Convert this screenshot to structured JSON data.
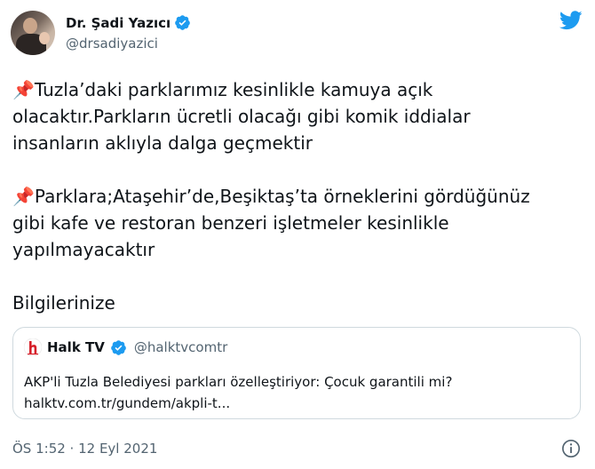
{
  "author": {
    "display_name": "Dr. Şadi Yazıcı",
    "handle": "@drsadiyazici"
  },
  "tweet": {
    "paragraph1": "Tuzla’daki parklarımız kesinlikle kamuya açık\nolacaktır.Parkların ücretli olacağı gibi komik iddialar\ninsanların aklıyla dalga geçmektir",
    "paragraph2": "Parklara;Ataşehir’de,Beşiktaş’ta örneklerini gördüğünüz\ngibi kafe ve restoran benzeri işletmeler kesinlikle\nyapılmayacaktır",
    "paragraph3": "Bilgilerinize",
    "pin_emoji": "📌"
  },
  "quoted": {
    "name": "Halk TV",
    "handle": "@halktvcomtr",
    "title": "AKP'li Tuzla Belediyesi parkları özelleştiriyor: Çocuk garantili mi?",
    "link": "halktv.com.tr/gundem/akpli-t..."
  },
  "timestamp": "ÖS 1:52 · 12 Eyl 2021",
  "icons": {
    "verified": "verified-badge-icon",
    "twitter": "twitter-bird-icon",
    "info": "info-icon"
  },
  "colors": {
    "twitter_blue": "#1d9bf0",
    "muted": "#536471",
    "halk_red": "#d6202a"
  }
}
